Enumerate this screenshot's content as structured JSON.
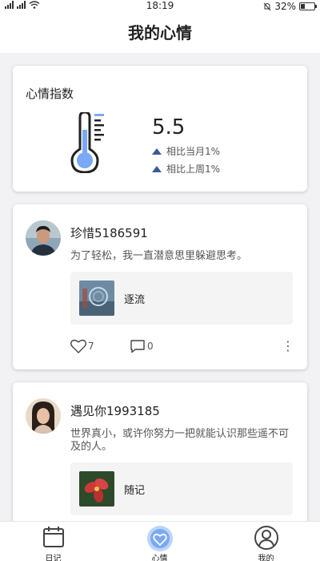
{
  "status_bar": {
    "time": "18:19",
    "battery": "32%",
    "battery_level": 0.32,
    "icons": [
      "signal-icon",
      "signal-icon",
      "wifi-icon",
      "mute-bell-icon",
      "battery-icon"
    ]
  },
  "header": {
    "title": "我的心情"
  },
  "mood": {
    "title": "心情指数",
    "value": "5.5",
    "compare_month": "相比当月1%",
    "compare_week": "相比上周1%",
    "icon": "thermometer-icon",
    "accent": "#7aa9f5"
  },
  "posts": [
    {
      "name": "珍惜5186591",
      "text": "为了轻松，我一直潜意思里躲避思考。",
      "attachment": "逐流",
      "likes": "7",
      "comments": "0"
    },
    {
      "name": "遇见你1993185",
      "text": "世界真小，或许你努力一把就能认识那些遥不可及的人。",
      "attachment": "随记"
    }
  ],
  "nav": {
    "items": [
      {
        "label": "日记",
        "icon": "calendar-icon"
      },
      {
        "label": "心情",
        "icon": "heart-icon"
      },
      {
        "label": "我的",
        "icon": "user-icon"
      }
    ],
    "active_color": "#7aa9f5"
  }
}
